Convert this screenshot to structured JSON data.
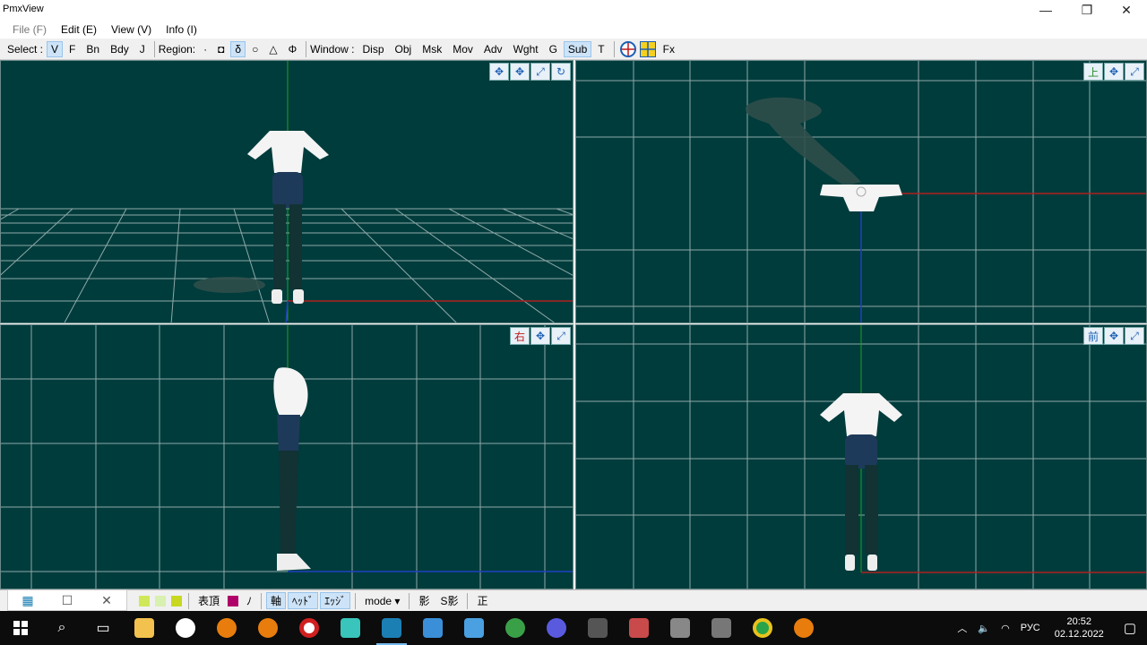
{
  "window": {
    "title": "PmxView",
    "minimize": "—",
    "restore": "❐",
    "close": "✕"
  },
  "menu": [
    {
      "label": "File (F)",
      "disabled": true
    },
    {
      "label": "Edit (E)",
      "disabled": false
    },
    {
      "label": "View (V)",
      "disabled": false
    },
    {
      "label": "Info (I)",
      "disabled": false
    }
  ],
  "toolbar": {
    "select_label": "Select :",
    "select_items": [
      {
        "label": "V",
        "on": true
      },
      {
        "label": "F",
        "on": false
      },
      {
        "label": "Bn",
        "on": false
      },
      {
        "label": "Bdy",
        "on": false
      },
      {
        "label": "J",
        "on": false
      }
    ],
    "region_label": "Region:",
    "region_items": [
      {
        "label": "·",
        "on": false
      },
      {
        "label": "◘",
        "on": false
      },
      {
        "label": "δ",
        "on": true
      },
      {
        "label": "○",
        "on": false
      },
      {
        "label": "△",
        "on": false
      },
      {
        "label": "Φ",
        "on": false
      }
    ],
    "window_label": "Window :",
    "window_items": [
      {
        "label": "Disp",
        "on": false
      },
      {
        "label": "Obj",
        "on": false
      },
      {
        "label": "Msk",
        "on": false
      },
      {
        "label": "Mov",
        "on": false
      },
      {
        "label": "Adv",
        "on": false
      },
      {
        "label": "Wght",
        "on": false
      },
      {
        "label": "G",
        "on": false
      },
      {
        "label": "Sub",
        "on": true
      },
      {
        "label": "T",
        "on": false
      }
    ],
    "fx_label": "Fx"
  },
  "viewports": {
    "perspective": {
      "buttons": [
        "✥",
        "✥",
        "⤢",
        "↻"
      ]
    },
    "top": {
      "view_label": "上",
      "buttons": [
        "✥",
        "⤢"
      ]
    },
    "right": {
      "view_label": "右",
      "buttons": [
        "✥",
        "⤢"
      ]
    },
    "front": {
      "view_label": "前",
      "buttons": [
        "✥",
        "⤢"
      ]
    }
  },
  "bottombar": {
    "items": [
      {
        "label": "表頂",
        "on": false
      },
      {
        "label": "ﾉ",
        "on": false
      },
      {
        "label": "軸",
        "on": true
      },
      {
        "label": "ﾍｯﾄﾞ",
        "on": true
      },
      {
        "label": "ｴｯｼﾞ",
        "on": true
      },
      {
        "label": "mode ▾",
        "on": false
      },
      {
        "label": "影",
        "on": false
      },
      {
        "label": "S影",
        "on": false
      },
      {
        "label": "正",
        "on": false
      }
    ],
    "swatch_color": "#b0006a"
  },
  "taskbar": {
    "clock_time": "20:52",
    "clock_date": "02.12.2022",
    "language": "РУС"
  },
  "colors": {
    "viewport_bg": "#003c3c",
    "grid": "#8fa8a8",
    "axis_x": "#b02020",
    "axis_y": "#20a020",
    "axis_z": "#2040c0"
  }
}
